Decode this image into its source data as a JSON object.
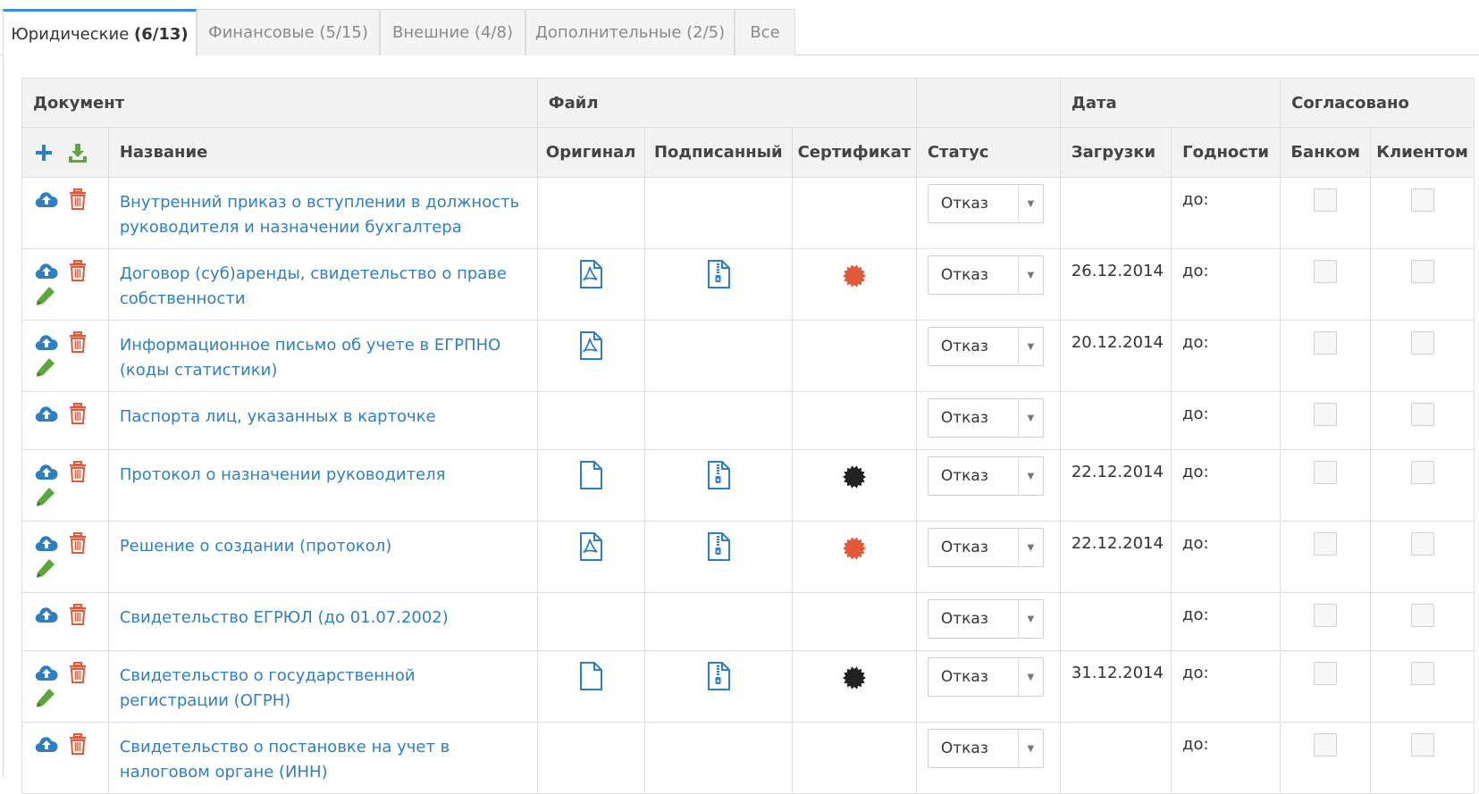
{
  "tabs": [
    {
      "label": "Юридические",
      "count": "(6/13)",
      "active": true
    },
    {
      "label": "Финансовые",
      "count": "(5/15)",
      "active": false
    },
    {
      "label": "Внешние",
      "count": "(4/8)",
      "active": false
    },
    {
      "label": "Дополнительные",
      "count": "(2/5)",
      "active": false
    },
    {
      "label": "Все",
      "count": "",
      "active": false
    }
  ],
  "table": {
    "group_headers": {
      "document": "Документ",
      "file": "Файл",
      "status": "",
      "date": "Дата",
      "approved": "Согласовано"
    },
    "sub_headers": {
      "name": "Название",
      "original": "Оригинал",
      "signed": "Подписанный",
      "certificate": "Сертификат",
      "status": "Статус",
      "upload": "Загрузки",
      "validity": "Годности",
      "bank": "Банком",
      "client": "Клиентом"
    },
    "rows": [
      {
        "name": "Внутренний приказ о вступлении в должность руководителя и назначении бухгалтера",
        "editable": false,
        "original": "",
        "signed": false,
        "cert": "",
        "status": "Отказ",
        "upload_date": "",
        "valid_until": "до:"
      },
      {
        "name": "Договор (суб)аренды, свидетельство о праве собственности",
        "editable": true,
        "original": "pdf",
        "signed": true,
        "cert": "#e05a3a",
        "status": "Отказ",
        "upload_date": "26.12.2014",
        "valid_until": "до:"
      },
      {
        "name": "Информационное письмо об учете в ЕГРПНО (коды статистики)",
        "editable": true,
        "original": "pdf",
        "signed": false,
        "cert": "",
        "status": "Отказ",
        "upload_date": "20.12.2014",
        "valid_until": "до:"
      },
      {
        "name": "Паспорта лиц, указанных в карточке",
        "editable": false,
        "original": "",
        "signed": false,
        "cert": "",
        "status": "Отказ",
        "upload_date": "",
        "valid_until": "до:"
      },
      {
        "name": "Протокол о назначении руководителя",
        "editable": true,
        "original": "blank",
        "signed": true,
        "cert": "#222222",
        "status": "Отказ",
        "upload_date": "22.12.2014",
        "valid_until": "до:"
      },
      {
        "name": "Решение о создании (протокол)",
        "editable": true,
        "original": "pdf",
        "signed": true,
        "cert": "#e05a3a",
        "status": "Отказ",
        "upload_date": "22.12.2014",
        "valid_until": "до:"
      },
      {
        "name": "Свидетельство ЕГРЮЛ (до 01.07.2002)",
        "editable": false,
        "original": "",
        "signed": false,
        "cert": "",
        "status": "Отказ",
        "upload_date": "",
        "valid_until": "до:"
      },
      {
        "name": "Свидетельство о государственной регистрации (ОГРН)",
        "editable": true,
        "original": "blank",
        "signed": true,
        "cert": "#222222",
        "status": "Отказ",
        "upload_date": "31.12.2014",
        "valid_until": "до:"
      },
      {
        "name": "Свидетельство о постановке на учет в налоговом органе (ИНН)",
        "editable": false,
        "original": "",
        "signed": false,
        "cert": "",
        "status": "Отказ",
        "upload_date": "",
        "valid_until": "до:"
      }
    ]
  },
  "colors": {
    "accent": "#3a8fd6",
    "link": "#2d7fc4",
    "icon_blue": "#2d7fc4",
    "trash_red": "#e05a3a",
    "pencil_green": "#5aa83a",
    "download_green": "#5aa83a"
  },
  "icons": {
    "add": "plus-icon",
    "download": "download-icon",
    "upload": "cloud-upload-icon",
    "delete": "trash-icon",
    "edit": "pencil-icon",
    "pdf": "pdf-file-icon",
    "blank": "file-icon",
    "archive": "archive-file-icon",
    "certificate": "certificate-seal-icon"
  }
}
